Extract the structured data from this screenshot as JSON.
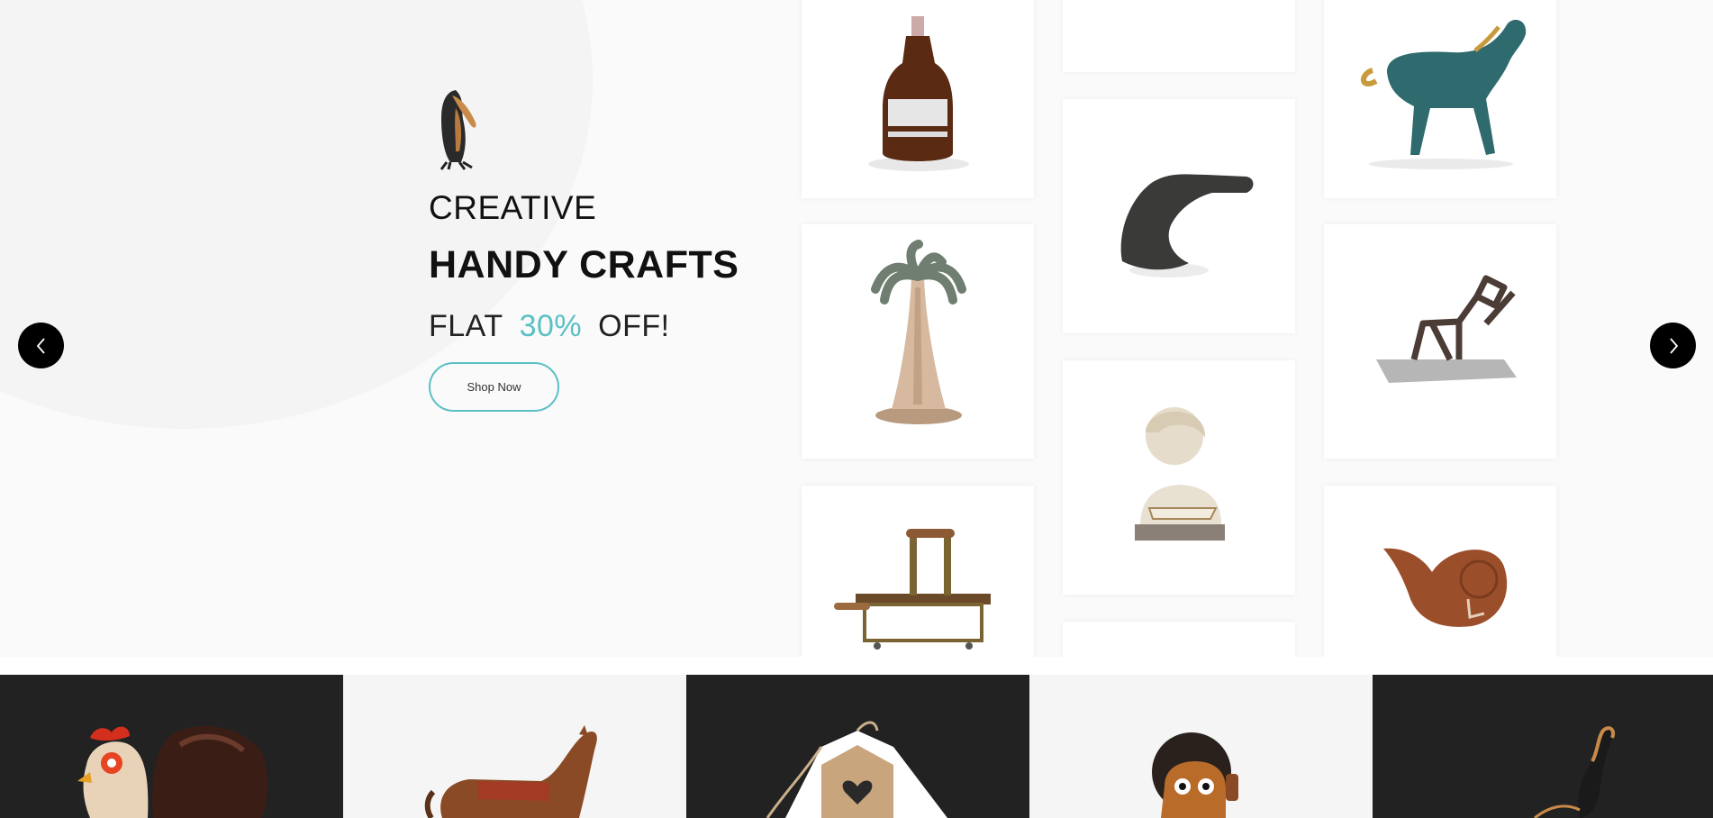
{
  "hero": {
    "kicker": "CREATIVE",
    "headline": "HANDY CRAFTS",
    "offer_prefix": "FLAT",
    "offer_percent": "30%",
    "offer_suffix": "OFF!",
    "button_label": "Shop Now",
    "accent_color": "#5bc0c5",
    "slider_prev_icon": "chevron-left-icon",
    "slider_next_icon": "chevron-right-icon"
  },
  "product_grid": {
    "tiles": [
      "growler-bottle-image",
      "horse-figurine-image",
      "palm-tree-lamp-image",
      "abstract-sculpture-image",
      "metal-figure-image",
      "reading-girl-bust-image",
      "antique-iron-image",
      "wooden-ladle-image"
    ]
  },
  "category_strip": {
    "items": [
      "rooster-image",
      "wooden-horse-image",
      "birdhouse-image",
      "monkey-toy-image",
      "swan-figurine-image"
    ]
  }
}
